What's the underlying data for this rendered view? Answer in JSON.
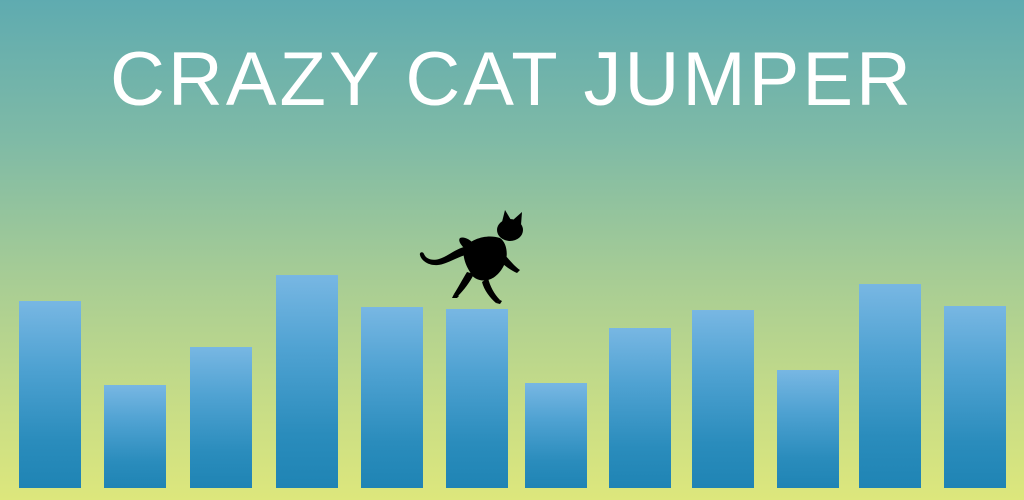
{
  "game": {
    "title": "CRAZY CAT JUMPER",
    "player": "cat-silhouette",
    "pillar_count": 12
  },
  "colors": {
    "sky_top": "#5fabb0",
    "sky_bottom": "#dde77c",
    "pillar_top": "#78b7e3",
    "pillar_bottom": "#1f84b4",
    "title": "#ffffff",
    "cat": "#000000"
  }
}
